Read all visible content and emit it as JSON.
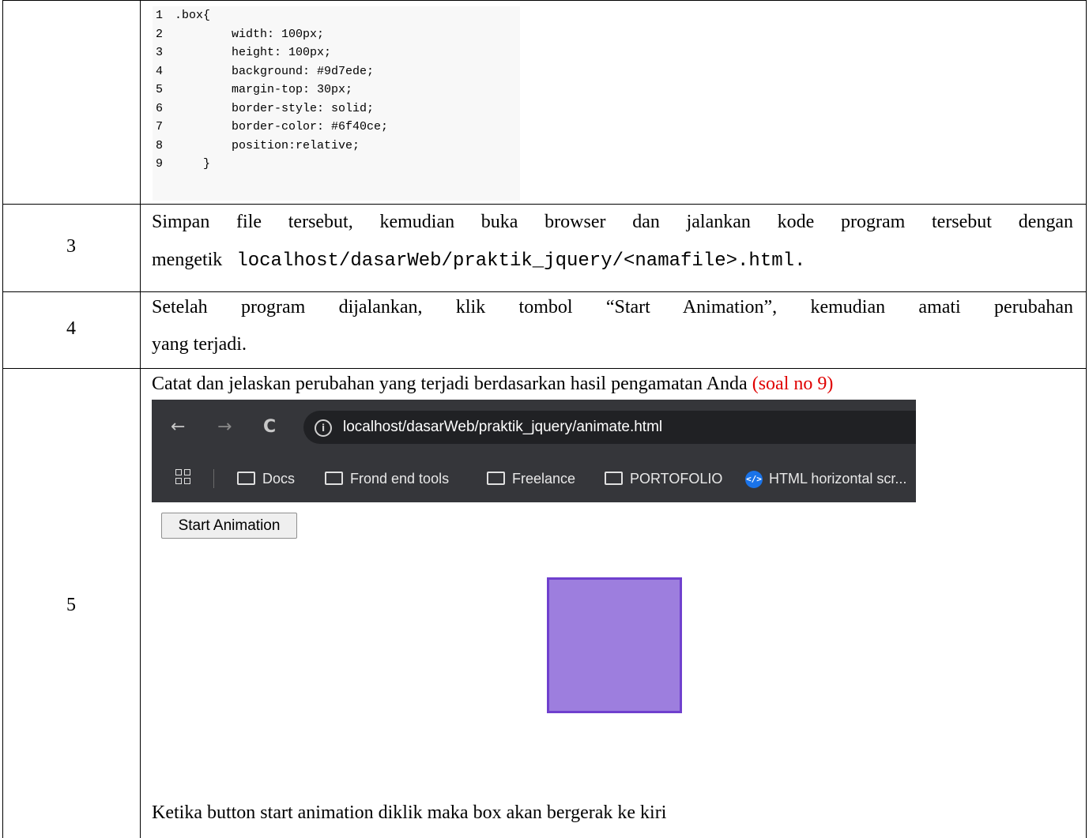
{
  "code": {
    "lines": [
      {
        "num": "1",
        "text": ".box{"
      },
      {
        "num": "2",
        "text": "        width: 100px;"
      },
      {
        "num": "3",
        "text": "        height: 100px;"
      },
      {
        "num": "4",
        "text": "        background: #9d7ede;"
      },
      {
        "num": "5",
        "text": "        margin-top: 30px;"
      },
      {
        "num": "6",
        "text": "        border-style: solid;"
      },
      {
        "num": "7",
        "text": "        border-color: #6f40ce;"
      },
      {
        "num": "8",
        "text": "        position:relative;"
      },
      {
        "num": "9",
        "text": "    }"
      }
    ]
  },
  "rows": [
    {
      "number": "3",
      "line1": "Simpan file tersebut, kemudian buka browser dan jalankan kode program tersebut dengan",
      "line2_prefix": "mengetik",
      "line2_code": "localhost/dasarWeb/praktik_jquery/<namafile>.html."
    },
    {
      "number": "4",
      "line1": "Setelah program dijalankan, klik tombol “Start Animation”, kemudian amati perubahan",
      "line2": "yang terjadi."
    },
    {
      "number": "5",
      "instruction": "Catat dan jelaskan perubahan yang terjadi berdasarkan hasil pengamatan Anda",
      "instruction_note": "(soal no 9)",
      "answer": "Ketika button start animation diklik maka box akan bergerak ke kiri"
    }
  ],
  "browser": {
    "url": "localhost/dasarWeb/praktik_jquery/animate.html",
    "bookmarks": [
      "Docs",
      "Frond end tools",
      "Freelance",
      "PORTOFOLIO",
      "HTML horizontal scr..."
    ],
    "button_label": "Start Animation",
    "box_colors": {
      "background": "#9d7ede",
      "border": "#6f40ce"
    }
  },
  "colors": {
    "note_red": "#e00000",
    "chrome_toolbar": "#35363a",
    "url_bar": "#202124"
  }
}
